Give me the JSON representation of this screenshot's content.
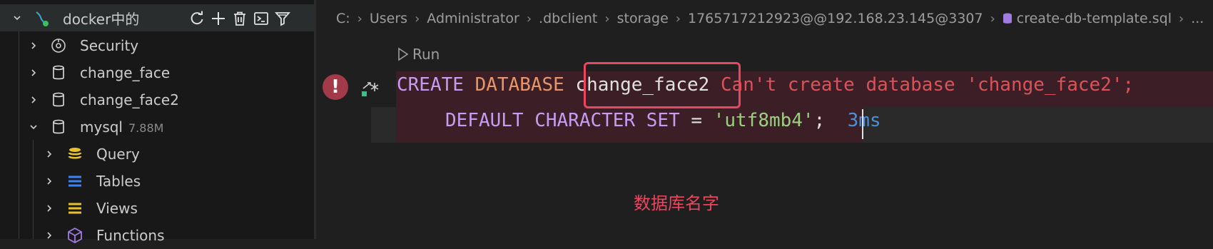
{
  "sidebar": {
    "root": {
      "label": "docker中的"
    },
    "toolbar": {
      "refresh_icon": "refresh-icon",
      "add_icon": "add-icon",
      "delete_icon": "trash-icon",
      "terminal_icon": "terminal-icon",
      "filter_icon": "filter-icon"
    },
    "items": [
      {
        "label": "Security",
        "icon": "security-icon"
      },
      {
        "label": "change_face",
        "icon": "database-icon"
      },
      {
        "label": "change_face2",
        "icon": "database-icon"
      },
      {
        "label": "mysql",
        "sub": "7.88M",
        "icon": "database-icon"
      },
      {
        "label": "Query",
        "icon": "query-icon"
      },
      {
        "label": "Tables",
        "icon": "tables-icon"
      },
      {
        "label": "Views",
        "icon": "views-icon"
      },
      {
        "label": "Functions",
        "icon": "functions-icon"
      }
    ]
  },
  "breadcrumb": [
    "C:",
    "Users",
    "Administrator",
    ".dbclient",
    "storage",
    "1765717212923@@192.168.23.145@3307",
    "create-db-template.sql",
    "..."
  ],
  "editor": {
    "run_label": "Run",
    "line1": {
      "kw_create": "CREATE",
      "kw_database": "DATABASE",
      "db_name": "change_face2",
      "error": "Can't create database 'change_face2';"
    },
    "line2": {
      "kw": "DEFAULT CHARACTER SET",
      "eq": "=",
      "value": "'utf8mb4'",
      "semi": ";",
      "duration": "3ms"
    }
  },
  "annotation": "数据库名字",
  "colors": {
    "accent_red": "#e9475e",
    "keyword": "#c79cf0",
    "string": "#9ad07f",
    "error": "#d9535a",
    "duration": "#4d8fd6"
  }
}
